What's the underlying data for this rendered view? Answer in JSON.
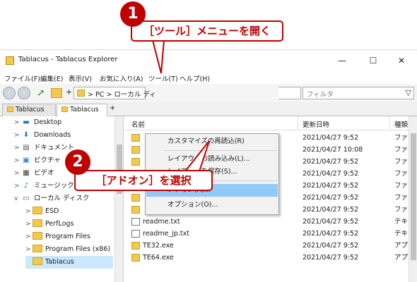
{
  "annotations": {
    "step1_number": "1",
    "step1_label": "［ツール］メニューを開く",
    "step2_number": "2",
    "step2_label": "［アドオン］を選択"
  },
  "window": {
    "title": "Tablacus - Tablacus Explorer",
    "minimize": "—",
    "maximize": "☐",
    "close": "✕"
  },
  "menubar": {
    "file": "ファイル(F)",
    "edit": "編集(E)",
    "view": "表示(V)",
    "favorites": "お気に入り(A)",
    "tools": "ツール(T)",
    "help": "ヘルプ(H)"
  },
  "toolbar": {
    "back_icon": "back-arrow",
    "forward_icon": "forward-arrow",
    "plus": "+",
    "address": "> PC > ローカル ディ",
    "filter_placeholder": "フィルタ",
    "filter_icon": "funnel"
  },
  "tabs": [
    {
      "label": "Tablacus",
      "active": false
    },
    {
      "label": "Tablacus",
      "active": true
    }
  ],
  "tab_add": "+",
  "tree": [
    {
      "label": "Desktop",
      "icon": "desktop-icon",
      "arrow": ">"
    },
    {
      "label": "Downloads",
      "icon": "downloads-icon",
      "arrow": ">"
    },
    {
      "label": "ドキュメント",
      "icon": "documents-icon",
      "arrow": ">"
    },
    {
      "label": "ピクチャ",
      "icon": "pictures-icon",
      "arrow": ">"
    },
    {
      "label": "ビデオ",
      "icon": "videos-icon",
      "arrow": ">"
    },
    {
      "label": "ミュージック",
      "icon": "music-icon",
      "arrow": ">"
    },
    {
      "label": "ローカル ディスク",
      "icon": "disk-icon",
      "arrow": "v"
    },
    {
      "label": "ESD",
      "icon": "folder-icon",
      "arrow": ">"
    },
    {
      "label": "PerfLogs",
      "icon": "folder-icon",
      "arrow": ">"
    },
    {
      "label": "Program Files",
      "icon": "folder-icon",
      "arrow": ">"
    },
    {
      "label": "Program Files (x86)",
      "icon": "folder-icon",
      "arrow": ">"
    },
    {
      "label": "Tablacus",
      "icon": "folder-icon",
      "arrow": "",
      "selected": true
    }
  ],
  "list": {
    "columns": [
      "名前",
      "更新日時",
      "種類"
    ],
    "rows": [
      {
        "name": "",
        "date": "2021/04/27 9:52",
        "type": "ファイル",
        "icon": "folder"
      },
      {
        "name": "",
        "date": "2021/04/27 10:08",
        "type": "ファイル",
        "icon": "folder"
      },
      {
        "name": "",
        "date": "2021/04/27 9:52",
        "type": "ファイル",
        "icon": "folder"
      },
      {
        "name": "",
        "date": "2021/04/27 9:52",
        "type": "ファイル",
        "icon": "folder"
      },
      {
        "name": "",
        "date": "2021/04/27 9:52",
        "type": "ファイル",
        "icon": "folder"
      },
      {
        "name": "",
        "date": "2021/04/27 9:52",
        "type": "ファイル",
        "icon": "folder"
      },
      {
        "name": "",
        "date": "2021/04/27 9:52",
        "type": "ファイル",
        "icon": "folder"
      },
      {
        "name": "readme.txt",
        "date": "2021/04/27 9:52",
        "type": "テキスト",
        "icon": "doc"
      },
      {
        "name": "readme_jp.txt",
        "date": "2021/04/27 9:52",
        "type": "テキスト",
        "icon": "doc"
      },
      {
        "name": "TE32.exe",
        "date": "2021/04/27 9:52",
        "type": "アプリケ",
        "icon": "exe"
      },
      {
        "name": "TE64.exe",
        "date": "2021/04/27 9:52",
        "type": "アプリケ",
        "icon": "exe"
      }
    ]
  },
  "tools_menu": {
    "items": [
      {
        "label": "カスタマイズの再読込(R)"
      },
      {
        "label": "レイアウトの読み込み(L)..."
      },
      {
        "label": "レイアウトを保存(S)..."
      },
      {
        "label": "アドオン(A)...",
        "highlighted": true
      },
      {
        "label": "オプション(O)..."
      }
    ]
  },
  "colors": {
    "annotation": "#c00000",
    "menu_highlight": "#91c9f7",
    "selection": "#cce8ff"
  }
}
